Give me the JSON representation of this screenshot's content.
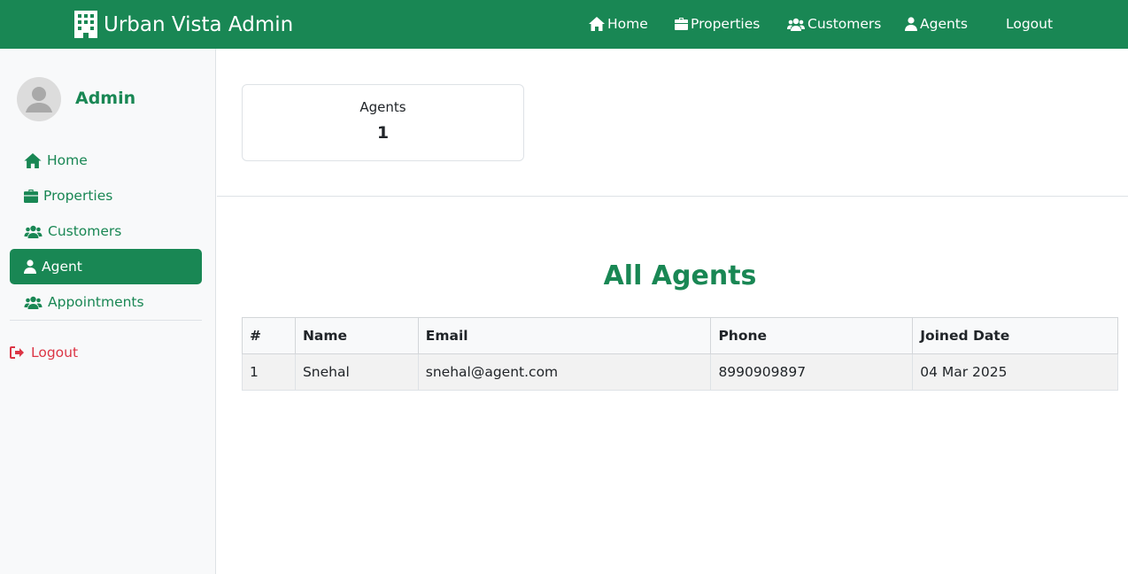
{
  "navbar": {
    "brand": "Urban Vista Admin",
    "links": {
      "home": "Home",
      "properties": "Properties",
      "customers": "Customers",
      "agents": "Agents",
      "logout": "Logout"
    },
    "color": "#198754"
  },
  "sidebar": {
    "user_name": "Admin",
    "items": [
      {
        "label": "Home",
        "icon": "home-icon"
      },
      {
        "label": "Properties",
        "icon": "briefcase-icon"
      },
      {
        "label": "Customers",
        "icon": "users-icon"
      },
      {
        "label": "Agent",
        "icon": "user-tie-icon",
        "active": true
      },
      {
        "label": "Appointments",
        "icon": "users-icon"
      }
    ],
    "logout": "Logout"
  },
  "stats": {
    "label": "Agents",
    "value": "1"
  },
  "agents_section": {
    "title": "All Agents",
    "columns": [
      "#",
      "Name",
      "Email",
      "Phone",
      "Joined Date"
    ],
    "rows": [
      [
        "1",
        "Snehal",
        "snehal@agent.com",
        "8990909897",
        "04 Mar 2025"
      ]
    ]
  },
  "colors": {
    "accent": "#198754",
    "danger": "#dc3545",
    "sidebar_bg": "#f8f9fa"
  }
}
